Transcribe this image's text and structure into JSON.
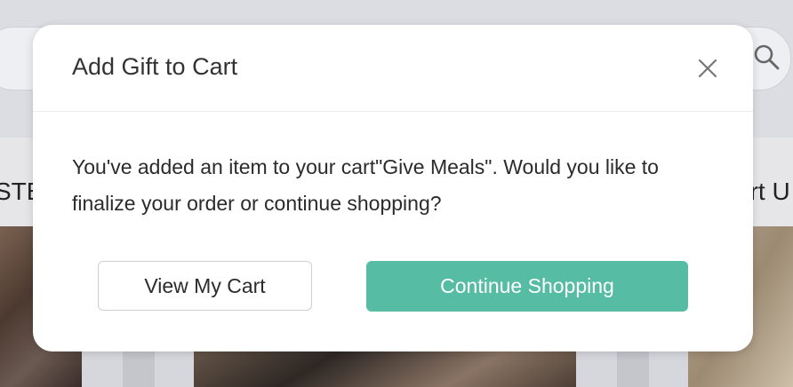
{
  "background": {
    "nav_left_text": "STE",
    "nav_right_text": "ort U",
    "search_icon": "search-icon"
  },
  "modal": {
    "title": "Add Gift to Cart",
    "close_icon": "close-icon",
    "message": "You've added an item to your cart\"Give Meals\". Would you like to finalize your order or continue shopping?",
    "view_cart_label": "View My Cart",
    "continue_label": "Continue Shopping"
  },
  "colors": {
    "accent": "#56bca4",
    "overlay_bg": "#c9c9cc"
  }
}
